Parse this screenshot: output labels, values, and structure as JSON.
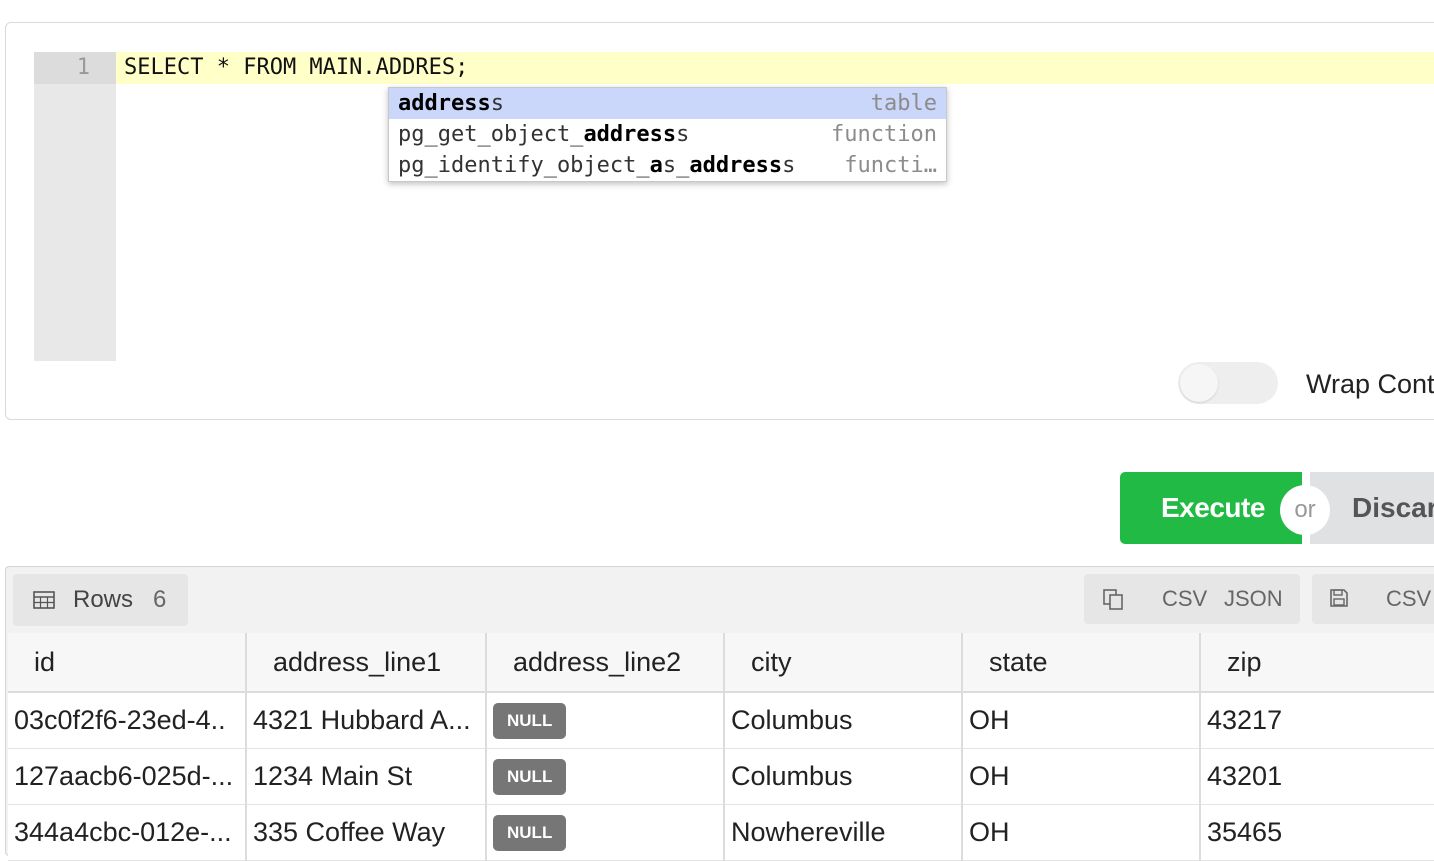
{
  "editor": {
    "line_number": "1",
    "code": "SELECT * FROM MAIN.ADDRES;",
    "autocomplete": [
      {
        "parts": [
          [
            "address",
            true
          ],
          [
            "s",
            false
          ]
        ],
        "kind": "table",
        "selected": true
      },
      {
        "parts": [
          [
            "pg_get_object_",
            false
          ],
          [
            "address",
            true
          ],
          [
            "s",
            false
          ]
        ],
        "kind": "function",
        "selected": false
      },
      {
        "parts": [
          [
            "pg_identify_object_",
            false
          ],
          [
            "a",
            true
          ],
          [
            "s_",
            false
          ],
          [
            "address",
            true
          ],
          [
            "s",
            false
          ]
        ],
        "kind": "functi…",
        "selected": false
      }
    ],
    "wrap_label": "Wrap Cont"
  },
  "actions": {
    "execute_label": "Execute",
    "or_label": "or",
    "discard_label": "Discard"
  },
  "results": {
    "rows_label": "Rows",
    "rows_count": "6",
    "copy_csv": "CSV",
    "copy_json": "JSON",
    "save_csv": "CSV",
    "null_label": "NULL",
    "columns": [
      "id",
      "address_line1",
      "address_line2",
      "city",
      "state",
      "zip"
    ],
    "rows": [
      [
        "03c0f2f6-23ed-4..",
        "4321 Hubbard A...",
        null,
        "Columbus",
        "OH",
        "43217"
      ],
      [
        "127aacb6-025d-...",
        "1234 Main St",
        null,
        "Columbus",
        "OH",
        "43201"
      ],
      [
        "344a4cbc-012e-...",
        "335 Coffee Way",
        null,
        "Nowhereville",
        "OH",
        "35465"
      ]
    ]
  },
  "colors": {
    "execute": "#21ba45",
    "active_line": "#ffffc8",
    "autocomplete_selected": "#cad6fa",
    "null_badge": "#767676"
  }
}
